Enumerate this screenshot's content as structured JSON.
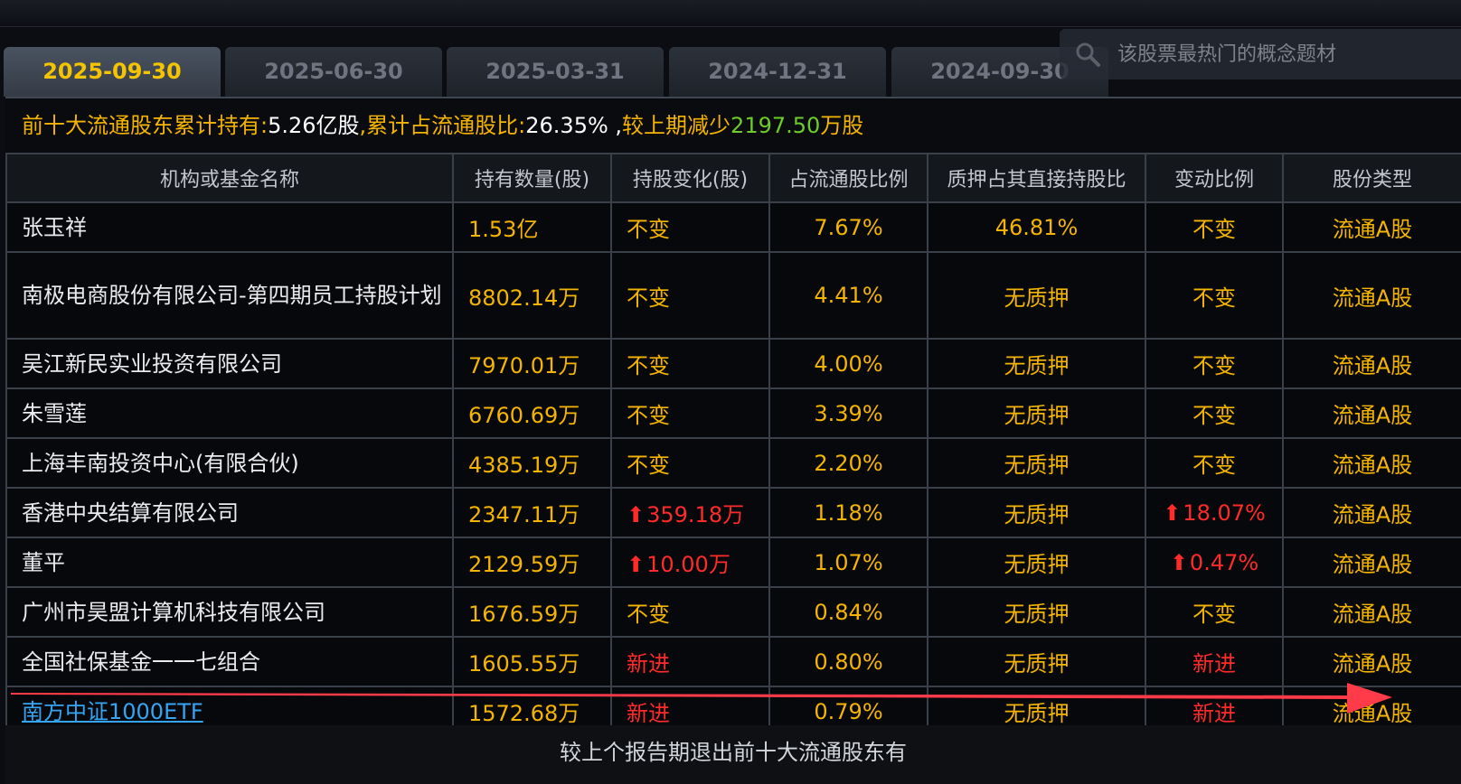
{
  "tabs": [
    {
      "label": "2025-09-30",
      "active": true
    },
    {
      "label": "2025-06-30",
      "active": false
    },
    {
      "label": "2025-03-31",
      "active": false
    },
    {
      "label": "2024-12-31",
      "active": false
    },
    {
      "label": "2024-09-30",
      "active": false
    }
  ],
  "search": {
    "placeholder": "该股票最热门的概念题材"
  },
  "summary": {
    "label1": "前十大流通股东累计持有:",
    "value1": "5.26亿股",
    "sep1": ",",
    "label2": "累计占流通股比:",
    "value2": "26.35% ,",
    "label3": "较上期减少",
    "value3": "2197.50",
    "unit3": "万股"
  },
  "table": {
    "headers": [
      "机构或基金名称",
      "持有数量(股)",
      "持股变化(股)",
      "占流通股比例",
      "质押占其直接持股比",
      "变动比例",
      "股份类型"
    ],
    "rows": [
      {
        "name": "张玉祥",
        "qty": "1.53亿",
        "change": "不变",
        "pct": "7.67%",
        "pledge": "46.81%",
        "ratio": "不变",
        "type": "流通A股"
      },
      {
        "name": "南极电商股份有限公司-第四期员工持股计划",
        "qty": "8802.14万",
        "change": "不变",
        "pct": "4.41%",
        "pledge": "无质押",
        "ratio": "不变",
        "type": "流通A股"
      },
      {
        "name": "吴江新民实业投资有限公司",
        "qty": "7970.01万",
        "change": "不变",
        "pct": "4.00%",
        "pledge": "无质押",
        "ratio": "不变",
        "type": "流通A股"
      },
      {
        "name": "朱雪莲",
        "qty": "6760.69万",
        "change": "不变",
        "pct": "3.39%",
        "pledge": "无质押",
        "ratio": "不变",
        "type": "流通A股"
      },
      {
        "name": "上海丰南投资中心(有限合伙)",
        "qty": "4385.19万",
        "change": "不变",
        "pct": "2.20%",
        "pledge": "无质押",
        "ratio": "不变",
        "type": "流通A股"
      },
      {
        "name": "香港中央结算有限公司",
        "qty": "2347.11万",
        "change": "359.18万",
        "pct": "1.18%",
        "pledge": "无质押",
        "ratio": "18.07%",
        "type": "流通A股"
      },
      {
        "name": "董平",
        "qty": "2129.59万",
        "change": "10.00万",
        "pct": "1.07%",
        "pledge": "无质押",
        "ratio": "0.47%",
        "type": "流通A股"
      },
      {
        "name": "广州市昊盟计算机科技有限公司",
        "qty": "1676.59万",
        "change": "不变",
        "pct": "0.84%",
        "pledge": "无质押",
        "ratio": "不变",
        "type": "流通A股"
      },
      {
        "name": "全国社保基金一一七组合",
        "qty": "1605.55万",
        "change": "新进",
        "pct": "0.80%",
        "pledge": "无质押",
        "ratio": "新进",
        "type": "流通A股"
      },
      {
        "name": "南方中证1000ETF",
        "qty": "1572.68万",
        "change": "新进",
        "pct": "0.79%",
        "pledge": "无质押",
        "ratio": "新进",
        "type": "流通A股"
      }
    ]
  },
  "footer": {
    "note": "较上个报告期退出前十大流通股东有"
  },
  "colors": {
    "accent": "#f5b400",
    "increase": "#ff2a2a",
    "decrease": "#6ccc29",
    "link": "#35a4f2",
    "annotation_arrow": "#ff3b4a"
  }
}
